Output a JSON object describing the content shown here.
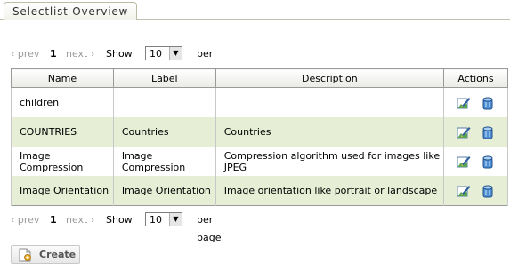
{
  "tab": {
    "title": "Selectlist Overview"
  },
  "pager": {
    "prev_label": "‹ prev",
    "current_page": "1",
    "next_label": "next ›",
    "show_label": "Show",
    "per_page_value": "10",
    "per_page_suffix": "per page"
  },
  "table": {
    "headers": [
      "Name",
      "Label",
      "Description",
      "Actions"
    ],
    "rows": [
      {
        "name": "children",
        "label": "",
        "description": ""
      },
      {
        "name": "COUNTRIES",
        "label": "Countries",
        "description": "Countries"
      },
      {
        "name": "Image Compression",
        "label": "Image Compression",
        "description": "Compression algorithm used for images like JPEG"
      },
      {
        "name": "Image Orientation",
        "label": "Image Orientation",
        "description": "Image orientation like portrait or landscape"
      }
    ],
    "action_icons": [
      "edit-icon",
      "delete-icon"
    ]
  },
  "create_button": {
    "label": "Create",
    "icon": "create-icon"
  },
  "colors": {
    "row_alt": "#e6efd6",
    "border": "#9a9a9a",
    "pager_disabled": "#9a9a9a"
  }
}
